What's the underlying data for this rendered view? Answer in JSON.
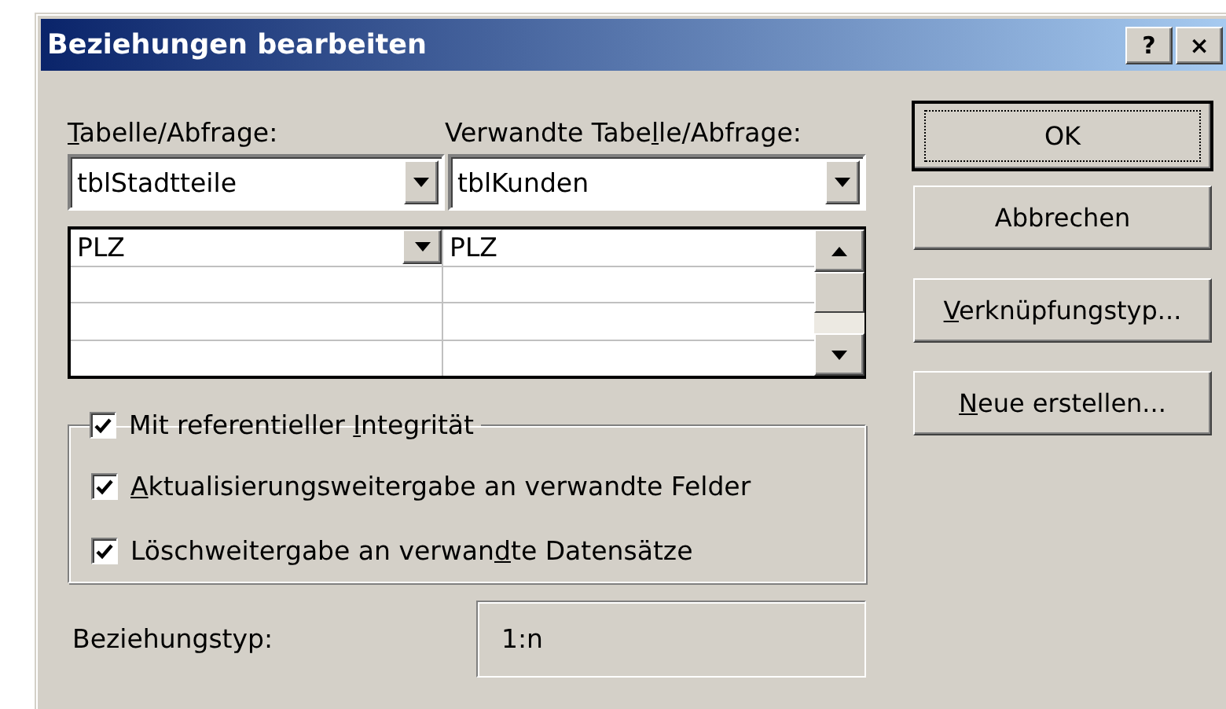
{
  "window": {
    "title": "Beziehungen bearbeiten",
    "help_button": "?",
    "close_button": "×"
  },
  "table": {
    "label": {
      "key": "T",
      "post": "abelle/Abfrage:"
    },
    "value": "tblStadtteile"
  },
  "related_table": {
    "label": {
      "pre": "Verwandte Tabe",
      "key": "l",
      "post": "le/Abfrage:"
    },
    "value": "tblKunden"
  },
  "fields": {
    "rows": [
      {
        "left": "PLZ",
        "right": "PLZ",
        "current": true
      }
    ]
  },
  "integrity": {
    "label": {
      "pre": "Mit referentieller ",
      "key": "I",
      "post": "ntegrität"
    },
    "checked": true
  },
  "options": [
    {
      "label": {
        "key": "A",
        "post": "ktualisierungsweitergabe an verwandte Felder"
      },
      "checked": true
    },
    {
      "label": {
        "pre": "Löschweitergabe an verwan",
        "key": "d",
        "post": "te Datensätze"
      },
      "checked": true
    }
  ],
  "relation_type": {
    "label": "Beziehungstyp:",
    "value": "1:n"
  },
  "buttons": [
    {
      "label": {
        "post": "OK"
      },
      "default": true
    },
    {
      "label": {
        "post": "Abbrechen"
      },
      "default": false
    },
    {
      "label": {
        "key": "V",
        "post": "erknüpfungstyp..."
      },
      "default": false
    },
    {
      "label": {
        "key": "N",
        "post": "eue erstellen..."
      },
      "default": false
    }
  ]
}
